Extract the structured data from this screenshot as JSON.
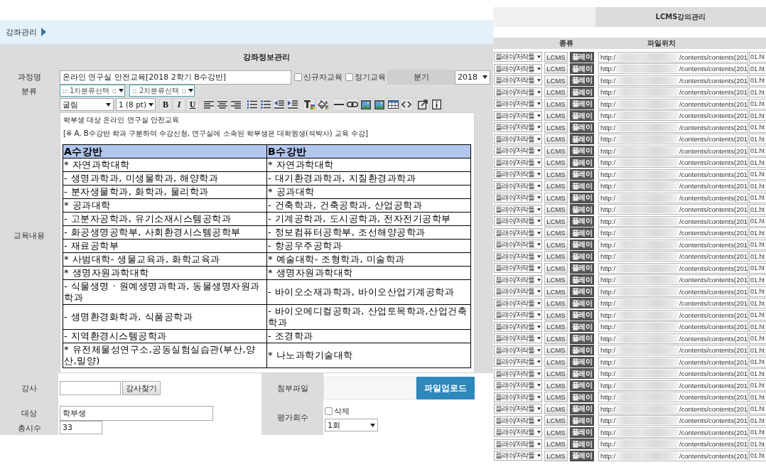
{
  "breadcrumb": {
    "title": "강좌관리"
  },
  "form": {
    "title": "강좌정보관리",
    "course_name": {
      "label": "과정명",
      "value": "온라인 연구실 안전교육[2018 2학기 B수강반]"
    },
    "options": [
      {
        "label": "신규자교육",
        "checked": false
      },
      {
        "label": "정기교육",
        "checked": false
      }
    ],
    "term": {
      "label": "분기",
      "value": "2018"
    },
    "category": {
      "label": "분류",
      "selects": [
        ":: 1차분류선택 ::",
        ":: 2차분류선택 ::"
      ]
    },
    "content": {
      "label": "교육내용",
      "toolbar": {
        "font": "굴림",
        "size": "1 (8 pt)",
        "groups": [
          [
            {
              "kind": "bold",
              "text": "B"
            },
            {
              "kind": "italic",
              "text": "I"
            },
            {
              "kind": "underline",
              "text": "U"
            }
          ],
          [
            {
              "kind": "align-left"
            },
            {
              "kind": "align-center"
            },
            {
              "kind": "align-right"
            }
          ],
          [
            {
              "kind": "ordered-list"
            },
            {
              "kind": "unordered-list"
            },
            {
              "kind": "outdent"
            },
            {
              "kind": "indent"
            }
          ],
          [
            {
              "kind": "text-color"
            },
            {
              "kind": "background-color"
            }
          ],
          [
            {
              "kind": "horizontal-rule"
            },
            {
              "kind": "link"
            },
            {
              "kind": "image"
            },
            {
              "kind": "image"
            },
            {
              "kind": "table"
            },
            {
              "kind": "source"
            }
          ],
          [
            {
              "kind": "popup"
            },
            {
              "kind": "info"
            }
          ]
        ]
      },
      "paragraphs": [
        "학부생 대상 온라인 연구실 안전교육",
        "[※ A, B수강반 학과 구분하여 수강신청, 연구실에 소속된 학부생은 대학원생(석박사) 교육 수강]"
      ],
      "table": {
        "columns": [
          "A수강반",
          "B수강반"
        ],
        "rows": [
          [
            "* 자연과학대학",
            "* 자연과학대학"
          ],
          [
            "- 생명과학과, 미생물학과, 해양학과",
            "- 대기환경과학과, 지질환경과학과"
          ],
          [
            "- 분자생물학과, 화학과, 물리학과",
            "* 공과대학"
          ],
          [
            "* 공과대학",
            "- 건축학과, 건축공학과, 산업공학과"
          ],
          [
            "- 고분자공학과, 유기소재시스템공학과",
            "- 기계공학과, 도시공학과, 전자전기공학부"
          ],
          [
            "- 화공생명공학부, 사회환경시스템공학부",
            "- 정보컴퓨터공학부, 조선해양공학과"
          ],
          [
            "- 재료공학부",
            "- 항공우주공학과"
          ],
          [
            "* 사범대학- 생물교육과, 화학교육과",
            "* 예술대학- 조형학과, 미술학과"
          ],
          [
            "* 생명자원과학대학",
            "* 생명자원과학대학"
          ],
          [
            "- 식물생명 · 원예생명과학과, 동물생명자원과학과",
            "- 바이오소재과학과, 바이오산업기계공학과"
          ],
          [
            "- 생명환경화학과, 식품공학과",
            "- 바이오메디컬공학과, 산업토목학과,산업건축학과"
          ],
          [
            "- 지역환경시스템공학과",
            "- 조경학과"
          ],
          [
            "* 유전체물성연구소,공동실험실습관(부산,양산,밀양)",
            "* 나노과학기술대학"
          ]
        ]
      }
    },
    "instructor": {
      "label": "강사",
      "button": "강사찾기"
    },
    "target": {
      "label": "대상",
      "value": "학부생"
    },
    "total_hours": {
      "label": "총시수",
      "value": "33"
    },
    "attachment": {
      "label": "첨부파일",
      "button": "파일업로드"
    },
    "evaluation": {
      "label": "평가회수",
      "delete": {
        "label": "삭제",
        "checked": false
      },
      "value": "1회"
    }
  },
  "lcms": {
    "title": "LCMS강의관리",
    "columns": [
      "종류",
      "파일위치"
    ],
    "rows": [
      {
        "type": "플래쉬/저작툴",
        "lcms": "LCMS",
        "play": "플레이",
        "path_start": "http:/",
        "path_end": "/contents/contents(201",
        "column_3": "01.ht"
      },
      {
        "type": "플래쉬/저작툴",
        "lcms": "LCMS",
        "play": "플레이",
        "path_start": "http:/",
        "path_end": "/contents/contents(201",
        "column_3": "01.ht"
      },
      {
        "type": "플래쉬/저작툴",
        "lcms": "LCMS",
        "play": "플레이",
        "path_start": "http:/",
        "path_end": "/contents/contents(201",
        "column_3": "01.ht"
      },
      {
        "type": "플래쉬/저작툴",
        "lcms": "LCMS",
        "play": "플레이",
        "path_start": "http:/",
        "path_end": "/contents/contents(201",
        "column_3": "01.ht"
      },
      {
        "type": "플래쉬/저작툴",
        "lcms": "LCMS",
        "play": "플레이",
        "path_start": "http:/",
        "path_end": "/contents/contents(201",
        "column_3": "01.ht"
      },
      {
        "type": "플래쉬/저작툴",
        "lcms": "LCMS",
        "play": "플레이",
        "path_start": "http:/",
        "path_end": "/contents/contents(201",
        "column_3": "01.ht"
      },
      {
        "type": "플래쉬/저작툴",
        "lcms": "LCMS",
        "play": "플레이",
        "path_start": "http:/",
        "path_end": "/contents/contents(201",
        "column_3": "01.ht"
      },
      {
        "type": "플래쉬/저작툴",
        "lcms": "LCMS",
        "play": "플레이",
        "path_start": "http:/",
        "path_end": "/contents/contents(201",
        "column_3": "01.ht"
      },
      {
        "type": "플래쉬/저작툴",
        "lcms": "LCMS",
        "play": "플레이",
        "path_start": "http:/",
        "path_end": "/contents/contents(201",
        "column_3": "01.ht"
      },
      {
        "type": "플래쉬/저작툴",
        "lcms": "LCMS",
        "play": "플레이",
        "path_start": "http:/",
        "path_end": "/contents/contents(201",
        "column_3": "01.ht"
      },
      {
        "type": "플래쉬/저작툴",
        "lcms": "LCMS",
        "play": "플레이",
        "path_start": "http:/",
        "path_end": "/contents/contents(201",
        "column_3": "01.ht"
      },
      {
        "type": "플래쉬/저작툴",
        "lcms": "LCMS",
        "play": "플레이",
        "path_start": "http:/",
        "path_end": "/contents/contents(201",
        "column_3": "01.ht"
      },
      {
        "type": "플래쉬/저작툴",
        "lcms": "LCMS",
        "play": "플레이",
        "path_start": "http:/",
        "path_end": "/contents/contents(201",
        "column_3": "01.ht"
      },
      {
        "type": "플래쉬/저작툴",
        "lcms": "LCMS",
        "play": "플레이",
        "path_start": "http:/",
        "path_end": "/contents/contents(201",
        "column_3": "01.ht"
      },
      {
        "type": "플래쉬/저작툴",
        "lcms": "LCMS",
        "play": "플레이",
        "path_start": "http:/",
        "path_end": "/contents/contents(201",
        "column_3": "01.ht"
      },
      {
        "type": "플래쉬/저작툴",
        "lcms": "LCMS",
        "play": "플레이",
        "path_start": "http:/",
        "path_end": "/contents/contents(201",
        "column_3": "01.ht"
      },
      {
        "type": "플래쉬/저작툴",
        "lcms": "LCMS",
        "play": "플레이",
        "path_start": "http:/",
        "path_end": "/contents/contents(201",
        "column_3": "01.ht"
      },
      {
        "type": "플래쉬/저작툴",
        "lcms": "LCMS",
        "play": "플레이",
        "path_start": "http:/",
        "path_end": "/contents/contents(201",
        "column_3": "01.ht"
      },
      {
        "type": "플래쉬/저작툴",
        "lcms": "LCMS",
        "play": "플레이",
        "path_start": "http:/",
        "path_end": "/contents/contents(201",
        "column_3": "01.ht"
      },
      {
        "type": "플래쉬/저작툴",
        "lcms": "LCMS",
        "play": "플레이",
        "path_start": "http:/",
        "path_end": "/contents/contents(201",
        "column_3": "01.ht"
      },
      {
        "type": "플래쉬/저작툴",
        "lcms": "LCMS",
        "play": "플레이",
        "path_start": "http:/",
        "path_end": "/contents/contents(201",
        "column_3": "01.ht"
      },
      {
        "type": "플래쉬/저작툴",
        "lcms": "LCMS",
        "play": "플레이",
        "path_start": "http:/",
        "path_end": "/contents/contents(201",
        "column_3": "01.ht"
      },
      {
        "type": "플래쉬/저작툴",
        "lcms": "LCMS",
        "play": "플레이",
        "path_start": "http:/",
        "path_end": "/contents/contents(201",
        "column_3": "01.ht"
      },
      {
        "type": "플래쉬/저작툴",
        "lcms": "LCMS",
        "play": "플레이",
        "path_start": "http:/",
        "path_end": "/contents/contents(201",
        "column_3": "01.ht"
      },
      {
        "type": "플래쉬/저작툴",
        "lcms": "LCMS",
        "play": "플레이",
        "path_start": "http:/",
        "path_end": "/contents/contents(201",
        "column_3": "01.ht"
      },
      {
        "type": "플래쉬/저작툴",
        "lcms": "LCMS",
        "play": "플레이",
        "path_start": "http:/",
        "path_end": "/contents/contents(201",
        "column_3": "01.ht"
      },
      {
        "type": "플래쉬/저작툴",
        "lcms": "LCMS",
        "play": "플레이",
        "path_start": "http:/",
        "path_end": "/contents/contents(201",
        "column_3": "01.ht"
      },
      {
        "type": "플래쉬/저작툴",
        "lcms": "LCMS",
        "play": "플레이",
        "path_start": "http:/",
        "path_end": "/contents/contents(201",
        "column_3": "01.ht"
      },
      {
        "type": "플래쉬/저작툴",
        "lcms": "LCMS",
        "play": "플레이",
        "path_start": "http:/",
        "path_end": "/contents/contents(201",
        "column_3": "01.ht"
      },
      {
        "type": "플래쉬/저작툴",
        "lcms": "LCMS",
        "play": "플레이",
        "path_start": "http:/",
        "path_end": "/contents/contents(201",
        "column_3": "01.ht"
      },
      {
        "type": "플래쉬/저작툴",
        "lcms": "LCMS",
        "play": "플레이",
        "path_start": "http:/",
        "path_end": "/contents/contents(201",
        "column_3": "01.ht"
      },
      {
        "type": "플래쉬/저작툴",
        "lcms": "LCMS",
        "play": "플레이",
        "path_start": "http:/",
        "path_end": "/contents/contents(201",
        "column_3": "01.ht"
      },
      {
        "type": "플래쉬/저작툴",
        "lcms": "LCMS",
        "play": "플레이",
        "path_start": "http:/",
        "path_end": "/contents/contents(201",
        "column_3": "01.ht"
      },
      {
        "type": "플래쉬/저작툴",
        "lcms": "LCMS",
        "play": "플레이",
        "path_start": "http:/",
        "path_end": "/contents/contents(201",
        "column_3": "01.ht"
      },
      {
        "type": "플래쉬/저작툴",
        "lcms": "LCMS",
        "play": "플레이",
        "path_start": "http:/",
        "path_end": "/contents/contents(201",
        "column_3": "01.ht"
      }
    ]
  }
}
